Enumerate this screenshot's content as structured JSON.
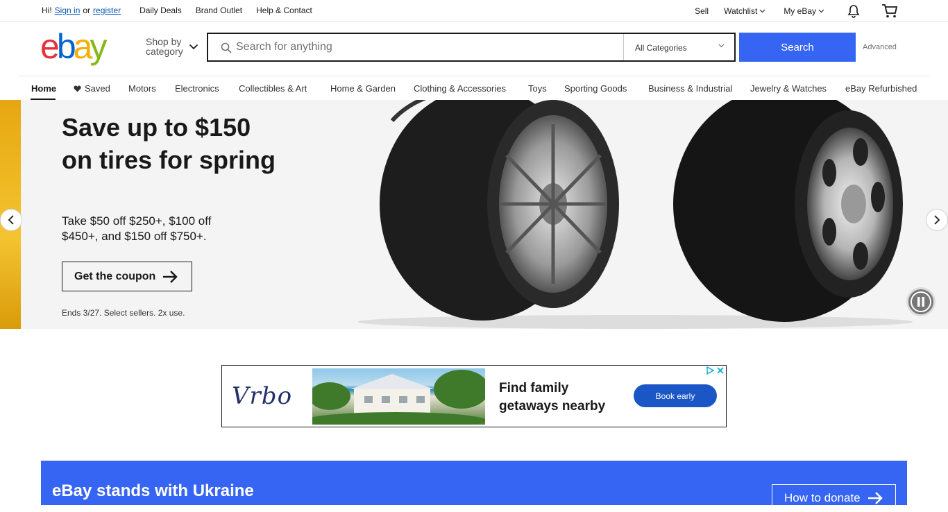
{
  "topbar": {
    "greeting": "Hi!",
    "sign_in": "Sign in",
    "or": "or",
    "register": "register",
    "links": [
      "Daily Deals",
      "Brand Outlet",
      "Help & Contact"
    ],
    "right": {
      "sell": "Sell",
      "watchlist": "Watchlist",
      "my_ebay": "My eBay",
      "notification_icon": "bell-icon",
      "cart_icon": "cart-icon"
    }
  },
  "header": {
    "logo": {
      "letters": [
        "e",
        "b",
        "a",
        "y"
      ],
      "colors": [
        "#e53238",
        "#0064d2",
        "#f5af02",
        "#86b817"
      ]
    },
    "shop_by_line1": "Shop by",
    "shop_by_line2": "category",
    "search": {
      "placeholder": "Search for anything",
      "value": ""
    },
    "category_select": "All Categories",
    "search_button": "Search",
    "advanced": "Advanced"
  },
  "nav": {
    "items": [
      "Home",
      "Saved",
      "Motors",
      "Electronics",
      "Collectibles & Art",
      "Home & Garden",
      "Clothing & Accessories",
      "Toys",
      "Sporting Goods",
      "Business & Industrial",
      "Jewelry & Watches",
      "eBay Refurbished"
    ],
    "active": "Home"
  },
  "hero": {
    "title": "Save up to $150 on tires for spring",
    "subtitle": "Take $50 off $250+, $100 off $450+, and $150 off $750+.",
    "cta": "Get the coupon",
    "fine_print": "Ends 3/27. Select sellers. 2x use."
  },
  "ad": {
    "brand": "Vrbo",
    "headline": "Find family getaways nearby",
    "button": "Book early"
  },
  "ukraine": {
    "title": "eBay stands with Ukraine",
    "button": "How to donate"
  },
  "colors": {
    "accent_blue": "#3665f3",
    "link_blue": "#0654ba",
    "ad_button": "#1b56c7"
  }
}
